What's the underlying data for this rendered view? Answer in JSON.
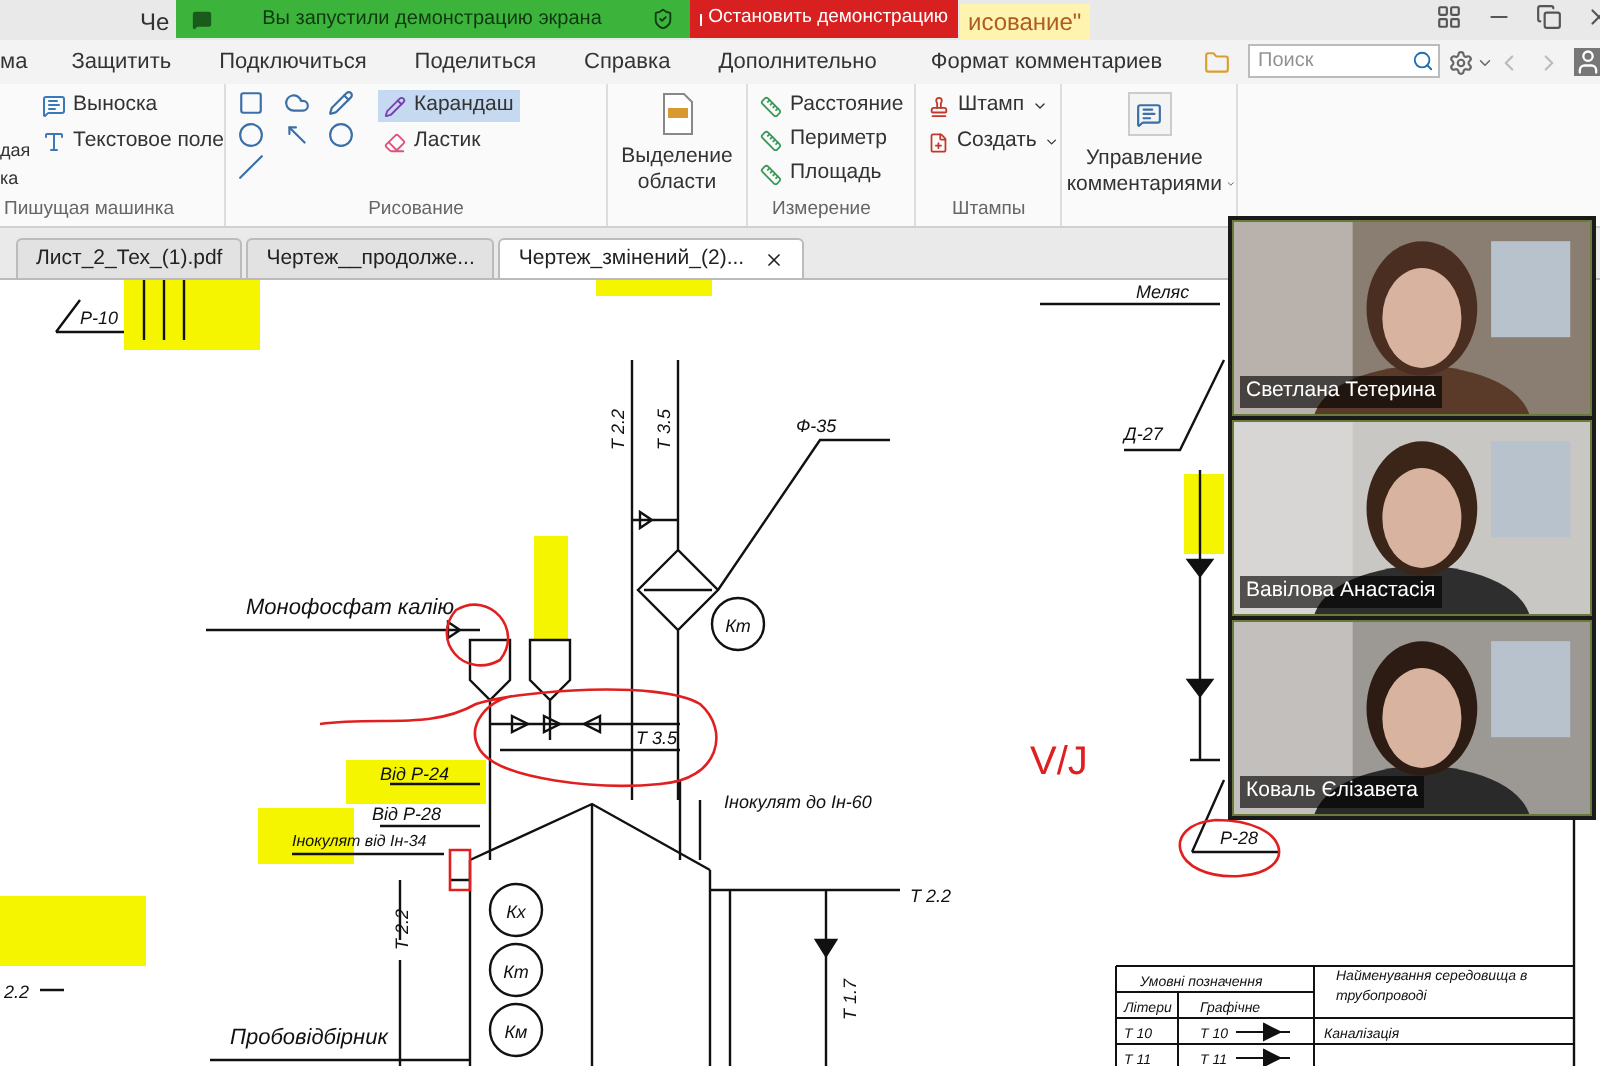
{
  "title_bar": {
    "title_left": "Че",
    "title_right": "исование\""
  },
  "share_banner": {
    "message": "Вы запустили демонстрацию экрана",
    "stop_button": "Остановить демонстрацию"
  },
  "menu": [
    "ма",
    "Защитить",
    "Подключиться",
    "Поделиться",
    "Справка",
    "Дополнительно",
    "Формат комментариев"
  ],
  "search": {
    "placeholder": "Поиск"
  },
  "ribbon": {
    "typewriter": {
      "partial_lines": [
        "дая",
        "ка"
      ],
      "items": [
        "Выноска",
        "Текстовое поле"
      ],
      "label": "Пишущая машинка"
    },
    "drawing": {
      "tools": [
        {
          "label": "Карандаш",
          "selected": true
        },
        {
          "label": "Ластик",
          "selected": false
        }
      ],
      "label": "Рисование"
    },
    "area_select": "Выделение области",
    "measure": {
      "items": [
        "Расстояние",
        "Периметр",
        "Площадь"
      ],
      "label": "Измерение"
    },
    "stamps": {
      "items": [
        "Штамп",
        "Создать"
      ],
      "label": "Штампы"
    },
    "manage": "Управление комментариями"
  },
  "tabs": [
    {
      "label": "Лист_2_Тех_(1).pdf",
      "selected": false
    },
    {
      "label": "Чертеж__продолже...",
      "selected": false
    },
    {
      "label": "Чертеж_змінений_(2)...",
      "selected": true
    }
  ],
  "drawing_labels": [
    "Р-10",
    "Монофосфат калію",
    "Кт",
    "Т 2.2",
    "Т 3.5",
    "Ф-35",
    "Меляс",
    "Д-27",
    "Від Р-24",
    "Від Р-28",
    "Інокулят від Ін-34",
    "Т 3.5",
    "Інокулят до Ін-60",
    "Кх",
    "Кт",
    "Км",
    "Т 2.2",
    "Т 2.2",
    "Т 1.7",
    "Пробовідбірник",
    "2.2",
    "Р-28"
  ],
  "annotation_text": "V/J",
  "legend": {
    "title": "Умовні позначення",
    "medium_heading": "Найменування середовища в трубопроводі",
    "letters_heading": "Літери",
    "graphic_heading": "Графічне",
    "rows": [
      {
        "letter": "Т 10",
        "graphic": "Т 10",
        "medium": "Каналізація"
      },
      {
        "letter": "Т 11",
        "graphic": "Т 11"
      }
    ]
  },
  "video_tiles": [
    {
      "name": "Светлана Тетерина"
    },
    {
      "name": "Вавілова Анастасія"
    },
    {
      "name": "Коваль Єлізавета"
    }
  ]
}
